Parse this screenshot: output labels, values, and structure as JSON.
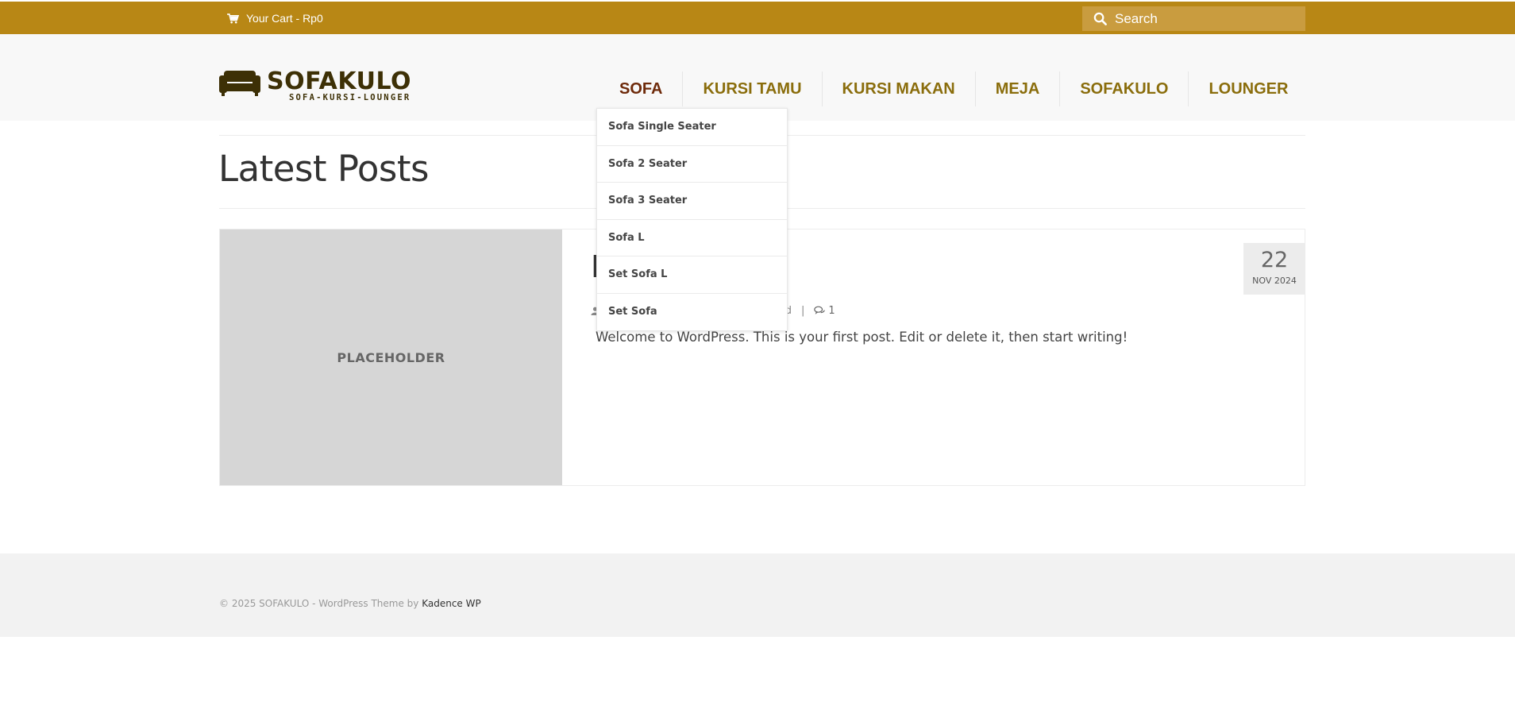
{
  "topbar": {
    "cart_label": "Your Cart - Rp0",
    "search_placeholder": "Search"
  },
  "header": {
    "logo_title": "SOFAKULO",
    "logo_subtitle": "SOFA-KURSI-LOUNGER",
    "nav": [
      {
        "label": "SOFA"
      },
      {
        "label": "KURSI TAMU"
      },
      {
        "label": "KURSI MAKAN"
      },
      {
        "label": "MEJA"
      },
      {
        "label": "SOFAKULO"
      },
      {
        "label": "LOUNGER"
      }
    ]
  },
  "dropdown": {
    "items": [
      {
        "label": "Sofa Single Seater"
      },
      {
        "label": "Sofa 2 Seater"
      },
      {
        "label": "Sofa 3 Seater"
      },
      {
        "label": "Sofa L"
      },
      {
        "label": "Set Sofa L"
      },
      {
        "label": "Set Sofa"
      }
    ]
  },
  "main": {
    "page_title": "Latest Posts",
    "post": {
      "thumbnail_label": "PLACEHOLDER",
      "title_visible": "H",
      "category_visible": "orized",
      "separator": "|",
      "comment_count": "1",
      "excerpt": "Welcome to WordPress. This is your first post. Edit or delete it, then start writing!",
      "date_day": "22",
      "date_month_year": "NOV 2024"
    }
  },
  "footer": {
    "copyright": "© 2025 SOFAKULO - WordPress Theme by ",
    "theme_link": "Kadence WP"
  },
  "colors": {
    "topbar": "#b88715",
    "nav_text": "#8a6d0c",
    "nav_active": "#6e2a0a",
    "logo": "#3d3006"
  }
}
